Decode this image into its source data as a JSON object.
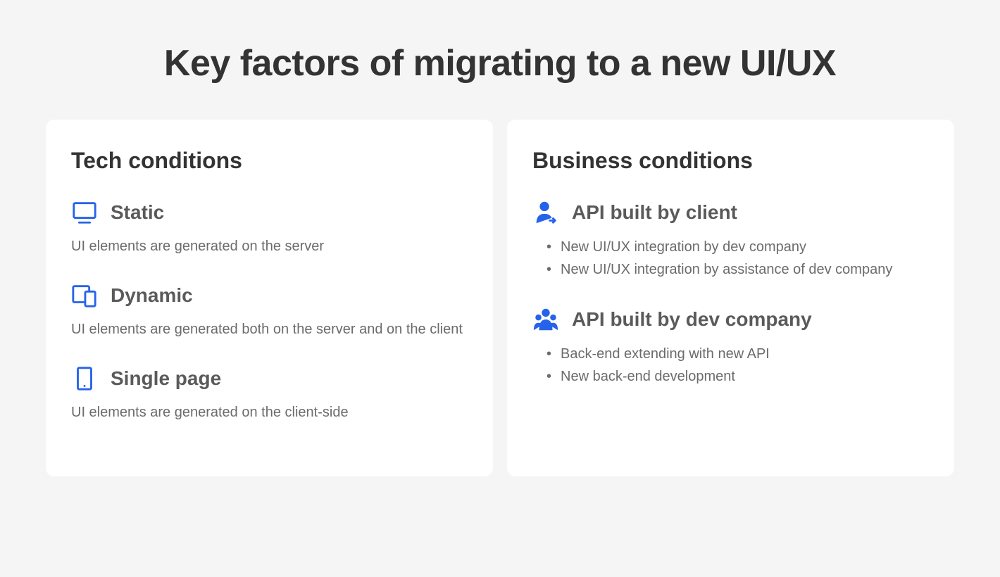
{
  "title": "Key factors of migrating to a new UI/UX",
  "left": {
    "title": "Tech conditions",
    "items": [
      {
        "icon": "monitor",
        "title": "Static",
        "desc": "UI elements are generated on the server"
      },
      {
        "icon": "devices",
        "title": "Dynamic",
        "desc": "UI elements are generated both on the server and on the client"
      },
      {
        "icon": "tablet",
        "title": "Single page",
        "desc": "UI elements are generated on the client-side"
      }
    ]
  },
  "right": {
    "title": "Business conditions",
    "items": [
      {
        "icon": "person-arrow",
        "title": "API built by client",
        "bullets": [
          "New UI/UX integration by dev company",
          "New UI/UX integration by assistance of dev company"
        ]
      },
      {
        "icon": "group",
        "title": "API built by dev company",
        "bullets": [
          "Back-end extending with new API",
          "New back-end development"
        ]
      }
    ]
  },
  "colors": {
    "accent": "#2563eb"
  }
}
